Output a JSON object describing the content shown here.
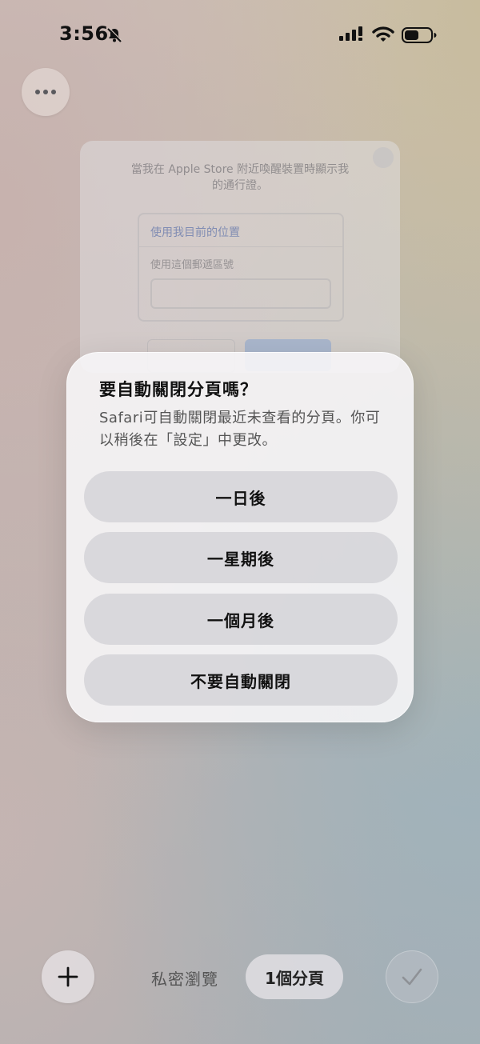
{
  "status_bar": {
    "time": "3:56"
  },
  "background_tab": {
    "prompt": "當我在 Apple Store 附近喚醒裝置時顯示我的通行證。",
    "option_current_location": "使用我目前的位置",
    "option_zip_code": "使用這個郵遞區號"
  },
  "alert": {
    "title": "要自動關閉分頁嗎？",
    "message": "Safari可自動關閉最近未查看的分頁。你可以稍後在「設定」中更改。",
    "options": [
      "一日後",
      "一星期後",
      "一個月後",
      "不要自動關閉"
    ]
  },
  "toolbar": {
    "private_label": "私密瀏覽",
    "tab_count_label": "1個分頁"
  },
  "colors": {
    "accent_blue": "#4a6fb3",
    "text_primary": "#111111",
    "text_secondary": "#555555"
  }
}
